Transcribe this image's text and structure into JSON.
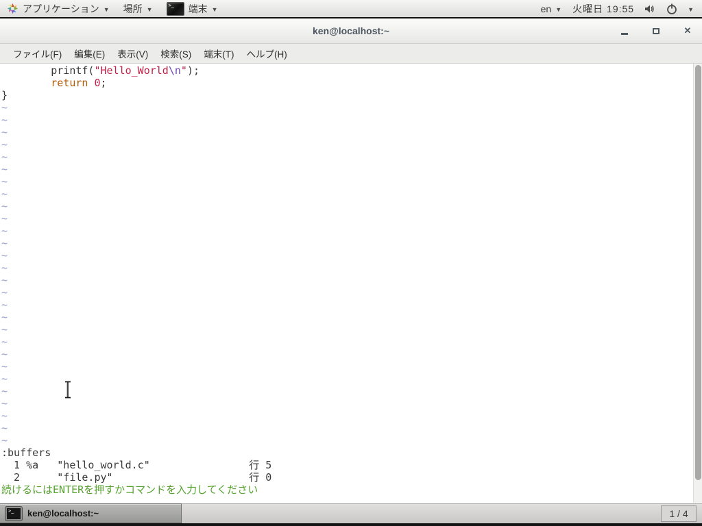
{
  "panel": {
    "applications_label": "アプリケーション",
    "places_label": "場所",
    "app_menu_label": "端末",
    "keyboard_layout": "en",
    "clock": "火曜日 19:55"
  },
  "window": {
    "title": "ken@localhost:~"
  },
  "menubar": {
    "items": [
      "ファイル(F)",
      "編集(E)",
      "表示(V)",
      "検索(S)",
      "端末(T)",
      "ヘルプ(H)"
    ]
  },
  "terminal": {
    "colors": {
      "foreground": "#383838",
      "background": "#ffffff",
      "string": "#c22148",
      "escape": "#7048b8",
      "keyword": "#b35900",
      "number": "#c22148",
      "tilde": "#98a0cc",
      "message_green": "#55a32e"
    },
    "lines": [
      {
        "segments": [
          {
            "t": "        printf(",
            "c": ""
          },
          {
            "t": "\"Hello_World",
            "c": "seg-str"
          },
          {
            "t": "\\n",
            "c": "seg-esc"
          },
          {
            "t": "\"",
            "c": "seg-str"
          },
          {
            "t": ");",
            "c": ""
          }
        ]
      },
      {
        "segments": [
          {
            "t": "        ",
            "c": ""
          },
          {
            "t": "return",
            "c": "seg-kw"
          },
          {
            "t": " ",
            "c": ""
          },
          {
            "t": "0",
            "c": "seg-num"
          },
          {
            "t": ";",
            "c": ""
          }
        ]
      },
      {
        "segments": [
          {
            "t": "}",
            "c": ""
          }
        ]
      },
      {
        "segments": [
          {
            "t": "~",
            "c": "seg-tilde"
          }
        ]
      },
      {
        "segments": [
          {
            "t": "~",
            "c": "seg-tilde"
          }
        ]
      },
      {
        "segments": [
          {
            "t": "~",
            "c": "seg-tilde"
          }
        ]
      },
      {
        "segments": [
          {
            "t": "~",
            "c": "seg-tilde"
          }
        ]
      },
      {
        "segments": [
          {
            "t": "~",
            "c": "seg-tilde"
          }
        ]
      },
      {
        "segments": [
          {
            "t": "~",
            "c": "seg-tilde"
          }
        ]
      },
      {
        "segments": [
          {
            "t": "~",
            "c": "seg-tilde"
          }
        ]
      },
      {
        "segments": [
          {
            "t": "~",
            "c": "seg-tilde"
          }
        ]
      },
      {
        "segments": [
          {
            "t": "~",
            "c": "seg-tilde"
          }
        ]
      },
      {
        "segments": [
          {
            "t": "~",
            "c": "seg-tilde"
          }
        ]
      },
      {
        "segments": [
          {
            "t": "~",
            "c": "seg-tilde"
          }
        ]
      },
      {
        "segments": [
          {
            "t": "~",
            "c": "seg-tilde"
          }
        ]
      },
      {
        "segments": [
          {
            "t": "~",
            "c": "seg-tilde"
          }
        ]
      },
      {
        "segments": [
          {
            "t": "~",
            "c": "seg-tilde"
          }
        ]
      },
      {
        "segments": [
          {
            "t": "~",
            "c": "seg-tilde"
          }
        ]
      },
      {
        "segments": [
          {
            "t": "~",
            "c": "seg-tilde"
          }
        ]
      },
      {
        "segments": [
          {
            "t": "~",
            "c": "seg-tilde"
          }
        ]
      },
      {
        "segments": [
          {
            "t": "~",
            "c": "seg-tilde"
          }
        ]
      },
      {
        "segments": [
          {
            "t": "~",
            "c": "seg-tilde"
          }
        ]
      },
      {
        "segments": [
          {
            "t": "~",
            "c": "seg-tilde"
          }
        ]
      },
      {
        "segments": [
          {
            "t": "~",
            "c": "seg-tilde"
          }
        ]
      },
      {
        "segments": [
          {
            "t": "~",
            "c": "seg-tilde"
          }
        ]
      },
      {
        "segments": [
          {
            "t": "~",
            "c": "seg-tilde"
          }
        ]
      },
      {
        "segments": [
          {
            "t": "~",
            "c": "seg-tilde"
          }
        ]
      },
      {
        "segments": [
          {
            "t": "~",
            "c": "seg-tilde"
          }
        ]
      },
      {
        "segments": [
          {
            "t": "~",
            "c": "seg-tilde"
          }
        ]
      },
      {
        "segments": [
          {
            "t": "~",
            "c": "seg-tilde"
          }
        ]
      },
      {
        "segments": [
          {
            "t": "~",
            "c": "seg-tilde"
          }
        ]
      },
      {
        "segments": [
          {
            "t": ":buffers",
            "c": ""
          }
        ]
      },
      {
        "segments": [
          {
            "t": "  1 %a   \"hello_world.c\"                行 5",
            "c": ""
          }
        ]
      },
      {
        "segments": [
          {
            "t": "  2      \"file.py\"                      行 0",
            "c": ""
          }
        ]
      },
      {
        "segments": [
          {
            "t": "続けるにはENTERを押すかコマンドを入力してください",
            "c": "seg-msg"
          }
        ]
      }
    ]
  },
  "taskbar": {
    "task_label": "ken@localhost:~",
    "workspace_indicator": "1 / 4"
  }
}
